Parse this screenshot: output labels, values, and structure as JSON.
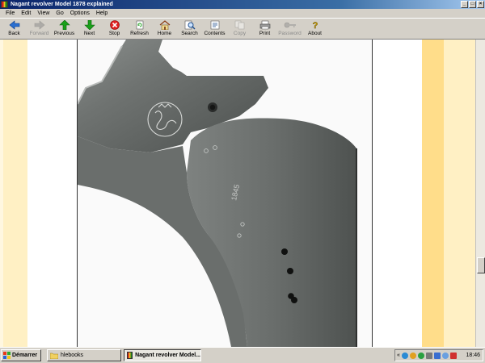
{
  "window": {
    "title": "Nagant revolver Model 1878 explained",
    "controls": {
      "minimize": "_",
      "maximize": "□",
      "close": "×"
    }
  },
  "menu": [
    "File",
    "Edit",
    "View",
    "Go",
    "Options",
    "Help"
  ],
  "toolbar": [
    {
      "label": "Back",
      "icon": "back-arrow-icon",
      "enabled": true
    },
    {
      "label": "Forward",
      "icon": "forward-arrow-icon",
      "enabled": false
    },
    {
      "label": "Previous",
      "icon": "up-arrow-icon",
      "enabled": true
    },
    {
      "label": "Next",
      "icon": "down-arrow-icon",
      "enabled": true
    },
    {
      "label": "Stop",
      "icon": "stop-icon",
      "enabled": true
    },
    {
      "label": "Refresh",
      "icon": "refresh-icon",
      "enabled": true
    },
    {
      "label": "Home",
      "icon": "home-icon",
      "enabled": true
    },
    {
      "label": "Search",
      "icon": "search-icon",
      "enabled": true
    },
    {
      "label": "Contents",
      "icon": "contents-icon",
      "enabled": true
    },
    {
      "label": "Copy",
      "icon": "copy-icon",
      "enabled": false
    },
    {
      "label": "Print",
      "icon": "print-icon",
      "enabled": true
    },
    {
      "label": "Password",
      "icon": "key-icon",
      "enabled": false
    },
    {
      "label": "About",
      "icon": "about-icon",
      "enabled": true
    }
  ],
  "photo": {
    "marking_number": "1845"
  },
  "taskbar": {
    "start_label": "Démarrer",
    "tasks": [
      {
        "label": "hlebooks",
        "icon": "folder-icon",
        "active": false
      },
      {
        "label": "Nagant revolver Model...",
        "icon": "ebook-icon",
        "active": true
      }
    ],
    "tray_chevron": "«",
    "clock": "18:46"
  },
  "colors": {
    "titlebar": "#0a246a",
    "chrome": "#d4d0c8",
    "band_light": "#fff0c4",
    "band_strong": "#ffdd8a",
    "stop_red": "#e02020",
    "arrow_green": "#1aa01a",
    "arrow_blue": "#2a6fd0"
  }
}
